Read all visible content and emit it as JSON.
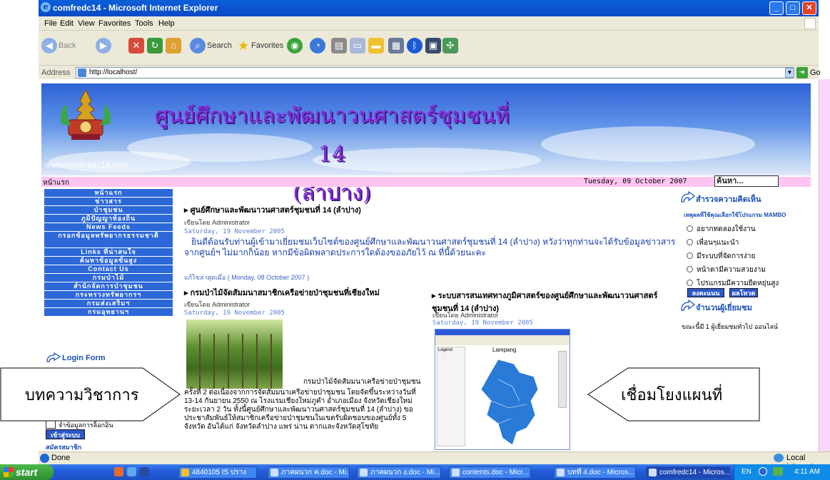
{
  "window": {
    "title": "comfredc14 - Microsoft Internet Explorer",
    "controls": [
      "_",
      "□",
      "✕"
    ]
  },
  "menu": [
    "File",
    "Edit",
    "View",
    "Favorites",
    "Tools",
    "Help"
  ],
  "toolbar": {
    "back": "Back",
    "search": "Search",
    "favorites": "Favorites"
  },
  "address": {
    "label": "Address",
    "url": "http://localhost/",
    "go": "Go"
  },
  "site": {
    "title_line1": "ศูนย์ศึกษาและพัฒนาวนศาสตร์ชุมชนที่ 14",
    "title_line2": "(ลำปาง)",
    "url": "www.comfredc14.com",
    "home": "หน้าแรก",
    "date": "Tuesday, 09 October 2007",
    "search_placeholder": "ค้นหา..."
  },
  "nav": [
    "หน้าแรก",
    "ข่าวสาร",
    "ป่าชุมชน",
    "ภูมิปัญญาท้องถิ่น",
    "News Feeds",
    "กรอกข้อมูลทรัพยากรธรรมชาติ",
    "Links ที่น่าสนใจ",
    "ค้นหาข้อมูลขั้นสูง",
    "Contact Us",
    "กรมป่าไม้",
    "สำนักจัดการป่าชุมชน",
    "กระทรวงทรัพยากรฯ",
    "กรมส่งเสริมฯ",
    "กรมอุทยานฯ"
  ],
  "login": {
    "title": "Login Form",
    "remember": "จำข้อมูลการล็อกอิน",
    "submit": "เข้าสู่ระบบ",
    "register": "สมัครสมาชิก"
  },
  "article1": {
    "title": "ศูนย์ศึกษาและพัฒนาวนศาสตร์ชุมชนที่ 14 (ลำปาง)",
    "author": "เขียนโดย Administrator",
    "date": "Saturday, 19 November 2005",
    "body": "ยินดีต้อนรับท่านผู้เข้ามาเยี่ยมชมเว็บไซต์ของศูนย์ศึกษาและพัฒนาวนศาสตร์ชุมชนที่ 14 (ลำปาง) หวังว่าทุกท่านจะได้รับข้อมูลข่าวสารจากศูนย์ฯ ไม่มากก็น้อย หากมีข้อผิดพลาดประการใดต้องขออภัยไว้ ณ ที่นี้ด้วยนะคะ",
    "updated": "แก้ไขล่าสุดเมื่อ ( Monday, 08 October 2007 )"
  },
  "article2": {
    "title": "กรมป่าไม้จัดสัมมนาสมาชิกเครือข่ายป่าชุมชนที่เชียงใหม่",
    "author": "เขียนโดย Administrator",
    "date": "Saturday, 19 November 2005",
    "body_lead": "กรมป่าไม้จัดสัมมนาเครือข่ายป่าชุมชน",
    "body": "ครั้งที่ 2 ต่อเนื่องจากการจัดสัมมนาเครือข่ายป่าชุมชน โดยจัดขึ้นระหว่างวันที่ 13-14 กันยายน 2550 ณ โรงแรมเชียงใหม่ภูคำ อำเภอเมือง จังหวัดเชียงใหม่ ระยะเวลา 2 วัน ทั้งนี้ศูนย์ศึกษาและพัฒนาวนศาสตร์ชุมชนที่ 14 (ลำปาง) ขอประชาสัมพันธ์ให้สมาชิกเครือข่ายป่าชุมชนในเขตรับผิดชอบของศูนย์ทั้ง 5 จังหวัด อันได้แก่ จังหวัดลำปาง แพร่ น่าน ตากและจังหวัดสุโขทัย"
  },
  "article3": {
    "title": "ระบบสารสนเทศทางภูมิศาสตร์ของศูนย์ศึกษาและพัฒนาวนศาสตร์ชุมชนที่ 14 (ลำปาง)",
    "author": "เขียนโดย Administrator",
    "date": "Saturday, 19 November 2005",
    "map_title": "Lampang",
    "legend_title": "Legend"
  },
  "right": {
    "poll_title": "สำรวจความคิดเห็น",
    "poll_question": "เหตุผลที่ใช้คุณเลือกใช้โปรแกรม MAMBO",
    "poll_options": [
      "อยากทดลองใช้งาน",
      "เพื่อนๆแนะนำ",
      "มีระบบที่จัดการง่าย",
      "หน้าตามีความสวยงาม",
      "โปรแกรมมีความยืดหยุ่นสูง"
    ],
    "vote": "ลงคะแนน",
    "results": "ผลโหวต",
    "visitors_title": "จำนวนผู้เยี่ยมชม",
    "visitors_text": "ขณะนี้มี 1 ผู้เยี่ยมชมทั่วไป ออนไลน์"
  },
  "callouts": {
    "left": "บทความวิชาการ",
    "right": "เชื่อมโยงแผนที่"
  },
  "status": {
    "text": "Done",
    "zone": "Local intranet"
  },
  "taskbar": {
    "start": "start",
    "tasks": [
      "4840105 IS ปราง",
      "ภาคผนวก ค.doc - Mi...",
      "ภาคผนวก ง.doc - Mi...",
      "contents.doc - Micr...",
      "บทที่ 4.doc - Micros...",
      "comfredc14 - Micros..."
    ],
    "lang": "EN",
    "clock": "4:11 AM"
  },
  "colors": {
    "nav_blue": "#2d68d8",
    "title_purple": "#8a2be2",
    "datebar_pink": "#ffc4f0",
    "xp_blue": "#0a4ac5"
  }
}
